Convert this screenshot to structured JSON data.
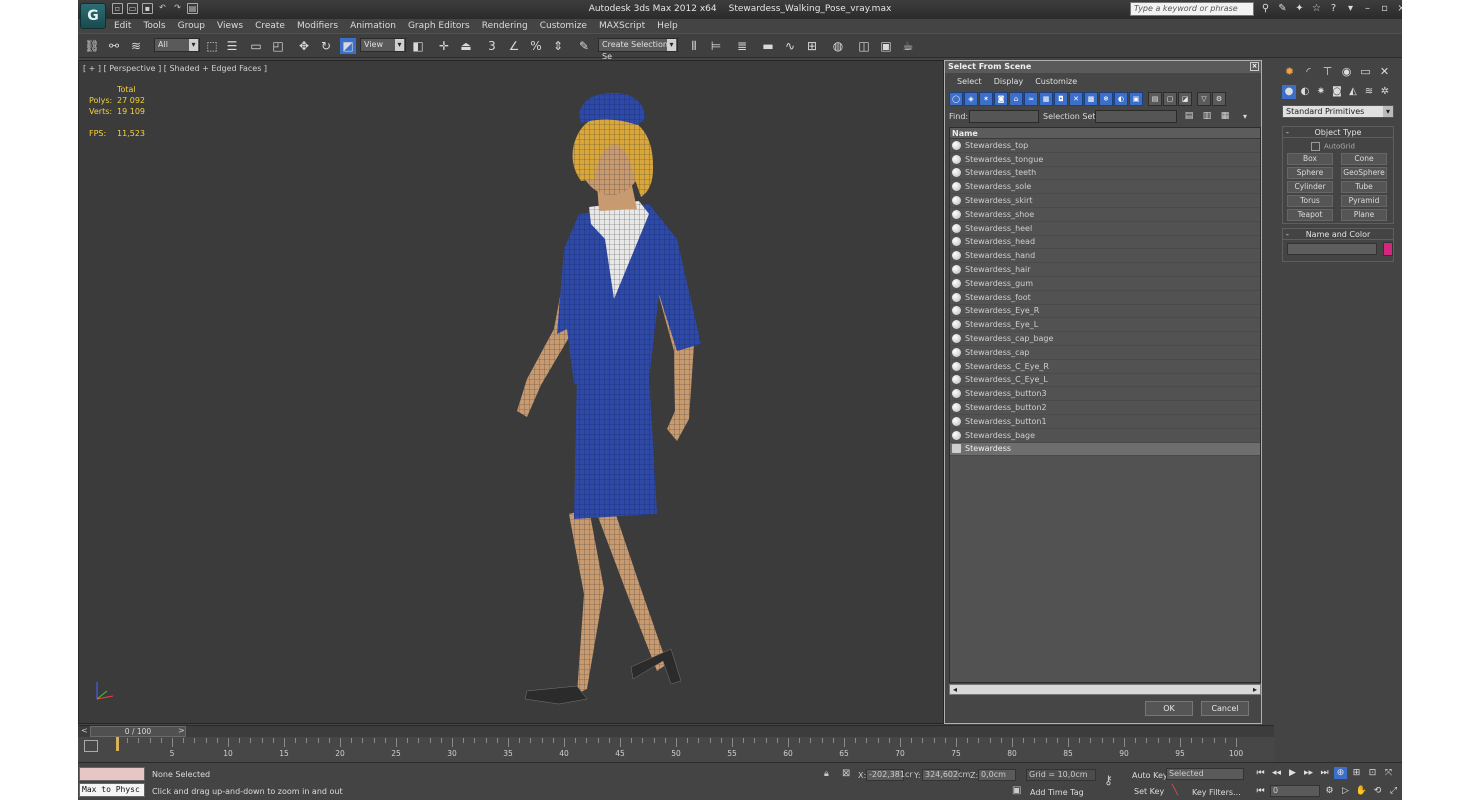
{
  "window": {
    "app_name": "Autodesk 3ds Max  2012 x64",
    "file_name": "Stewardess_Walking_Pose_vray.max",
    "search_placeholder": "Type a keyword or phrase"
  },
  "menu": [
    "Edit",
    "Tools",
    "Group",
    "Views",
    "Create",
    "Modifiers",
    "Animation",
    "Graph Editors",
    "Rendering",
    "Customize",
    "MAXScript",
    "Help"
  ],
  "toolbar": {
    "filter": "All",
    "ref_coord": "View",
    "selection_set": "Create Selection Se"
  },
  "viewport": {
    "label": "[ + ] [ Perspective ] [ Shaded + Edged Faces ]",
    "stats": {
      "total_label": "Total",
      "polys_label": "Polys:",
      "polys": "27 092",
      "verts_label": "Verts:",
      "verts": "19 109",
      "fps_label": "FPS:",
      "fps": "11,523"
    }
  },
  "dialog": {
    "title": "Select From Scene",
    "menu": [
      "Select",
      "Display",
      "Customize"
    ],
    "find_label": "Find:",
    "selection_set_label": "Selection Set:",
    "column_name": "Name",
    "items": [
      "Stewardess_top",
      "Stewardess_tongue",
      "Stewardess_teeth",
      "Stewardess_sole",
      "Stewardess_skirt",
      "Stewardess_shoe",
      "Stewardess_heel",
      "Stewardess_head",
      "Stewardess_hand",
      "Stewardess_hair",
      "Stewardess_gum",
      "Stewardess_foot",
      "Stewardess_Eye_R",
      "Stewardess_Eye_L",
      "Stewardess_cap_bage",
      "Stewardess_cap",
      "Stewardess_C_Eye_R",
      "Stewardess_C_Eye_L",
      "Stewardess_button3",
      "Stewardess_button2",
      "Stewardess_button1",
      "Stewardess_bage",
      "Stewardess"
    ],
    "selected_item": "Stewardess",
    "ok": "OK",
    "cancel": "Cancel"
  },
  "command_panel": {
    "category": "Standard Primitives",
    "object_type_title": "Object Type",
    "autogrid": "AutoGrid",
    "buttons": [
      "Box",
      "Cone",
      "Sphere",
      "GeoSphere",
      "Cylinder",
      "Tube",
      "Torus",
      "Pyramid",
      "Teapot",
      "Plane"
    ],
    "name_color_title": "Name and Color",
    "color": "#d3267c"
  },
  "timeline": {
    "frame": "0 / 100",
    "ticks": [
      "5",
      "10",
      "15",
      "20",
      "25",
      "30",
      "35",
      "40",
      "45",
      "50",
      "55",
      "60",
      "65",
      "70",
      "75",
      "80",
      "85",
      "90",
      "95",
      "100"
    ]
  },
  "status": {
    "maxscript": "Max to Physc",
    "selection": "None Selected",
    "prompt": "Click and drag up-and-down to zoom in and out",
    "x_label": "X:",
    "x": "-202,381cr",
    "y_label": "Y:",
    "y": "324,602cm",
    "z_label": "Z:",
    "z": "0,0cm",
    "grid": "Grid = 10,0cm",
    "add_time_tag": "Add Time Tag",
    "auto_key": "Auto Key",
    "set_key": "Set Key",
    "selected": "Selected",
    "key_filters": "Key Filters...",
    "frame_field": "0"
  }
}
